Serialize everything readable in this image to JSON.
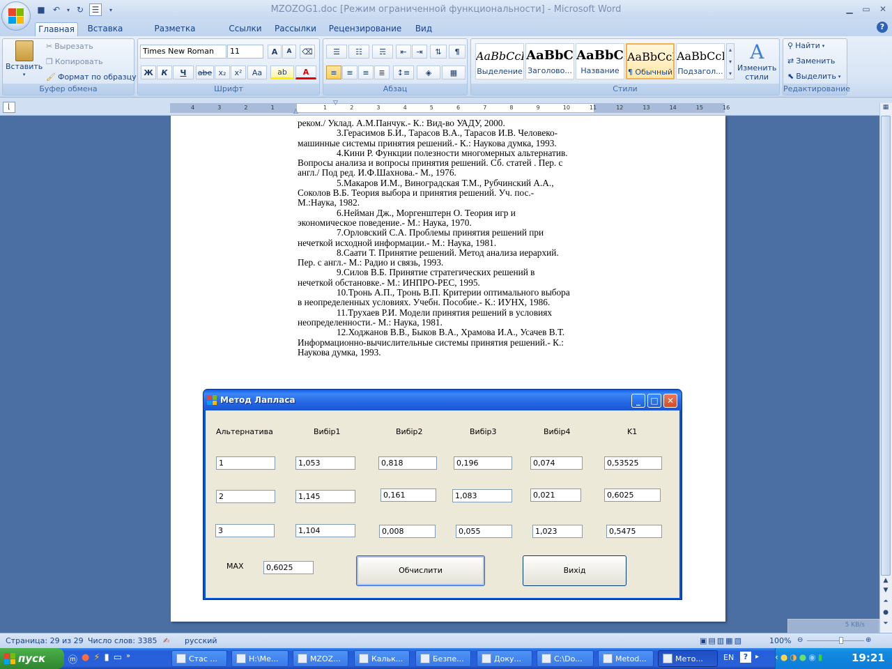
{
  "window": {
    "title": "MZOZOG1.doc [Режим ограниченной функциональности] - Microsoft Word"
  },
  "tabs": [
    "Главная",
    "Вставка",
    "Разметка страницы",
    "Ссылки",
    "Рассылки",
    "Рецензирование",
    "Вид"
  ],
  "ribbon": {
    "clipboard": {
      "paste": "Вставить",
      "cut": "Вырезать",
      "copy": "Копировать",
      "format_painter": "Формат по образцу",
      "label": "Буфер обмена"
    },
    "font": {
      "name": "Times New Roman",
      "size": "11",
      "label": "Шрифт",
      "grow": "A",
      "shrink": "A",
      "bold": "Ж",
      "italic": "К",
      "underline": "Ч",
      "strike": "abe",
      "subscript": "x₂",
      "superscript": "x²",
      "case": "Aa",
      "font_color": "A"
    },
    "paragraph": {
      "label": "Абзац"
    },
    "styles": {
      "label": "Стили",
      "items": [
        {
          "sample": "AaBbCcI",
          "name": "Выделение"
        },
        {
          "sample": "AaBbC",
          "name": "Заголово..."
        },
        {
          "sample": "AaBbC",
          "name": "Название"
        },
        {
          "sample": "AaBbCcI",
          "name": "¶ Обычный"
        },
        {
          "sample": "AaBbCcI",
          "name": "Подзагол..."
        }
      ],
      "change_line1": "Изменить",
      "change_line2": "стили"
    },
    "editing": {
      "label": "Редактирование",
      "find": "Найти",
      "replace": "Заменить",
      "select": "Выделить"
    }
  },
  "ruler": {
    "numbers": [
      "4",
      "3",
      "2",
      "1",
      "1",
      "2",
      "3",
      "4",
      "5",
      "6",
      "7",
      "8",
      "9",
      "10",
      "11",
      "12",
      "13",
      "14",
      "15",
      "16"
    ]
  },
  "document": {
    "lines": [
      {
        "text": "реком./ Уклад. А.М.Панчук.- К.: Вид-во УАДУ, 2000.",
        "indent": false
      },
      {
        "text": "3.Герасимов Б.И., Тарасов В.А., Тарасов И.В. Человеко-",
        "indent": true
      },
      {
        "text": "машинные системы принятия решений.- К.: Наукова думка, 1993.",
        "indent": false
      },
      {
        "text": "4.Кини Р. Функции полезности многомерных альтернатив.",
        "indent": true
      },
      {
        "text": "Вопросы анализа и вопросы принятия решений. Сб. статей . Пер. с",
        "indent": false
      },
      {
        "text": "англ./ Под ред. И.Ф.Шахнова.- М., 1976.",
        "indent": false
      },
      {
        "text": "5.Макаров И.М., Виноградская Т.М., Рубчинский А.А.,",
        "indent": true
      },
      {
        "text": "Соколов В.Б. Теория выбора и принятия решений. Уч. пос.-",
        "indent": false
      },
      {
        "text": "М.:Наука, 1982.",
        "indent": false
      },
      {
        "text": "6.Нейман Дж., Моргенштерн О. Теория игр и",
        "indent": true
      },
      {
        "text": "экономическое поведение.- М.: Наука, 1970.",
        "indent": false
      },
      {
        "text": "7.Орловский С.А. Проблемы принятия решений при",
        "indent": true
      },
      {
        "text": "нечеткой исходной информации.- М.: Наука, 1981.",
        "indent": false
      },
      {
        "text": "8.Саати Т. Принятие решений. Метод анализа иерархий.",
        "indent": true
      },
      {
        "text": "Пер. с англ.- М.: Радио и связь, 1993.",
        "indent": false
      },
      {
        "text": "9.Силов В.Б. Принятие стратегических решений в",
        "indent": true
      },
      {
        "text": "нечеткой обстановке.- М.: ИНПРО-РЕС, 1995.",
        "indent": false
      },
      {
        "text": "10.Тронь А.П., Тронь В.П. Критерии оптимального выбора",
        "indent": true
      },
      {
        "text": "в неопределенных условиях. Учебн. Пособие.- К.: ИУНХ, 1986.",
        "indent": false
      },
      {
        "text": "11.Трухаев Р.И. Модели принятия решений в условиях",
        "indent": true
      },
      {
        "text": "неопределенности.- М.: Наука, 1981.",
        "indent": false
      },
      {
        "text": "12.Ходжанов В.В., Быков В.А., Храмова И.А., Усачев В.Т.",
        "indent": true
      },
      {
        "text": "Информационно-вычислительные системы принятия решений.- К.:",
        "indent": false
      },
      {
        "text": "Наукова думка, 1993.",
        "indent": false
      }
    ]
  },
  "dialog": {
    "title": "Метод Лапласа",
    "headers": [
      "Альтернатива",
      "Вибір1",
      "Вибір2",
      "Вибір3",
      "Вибір4",
      "K1"
    ],
    "rows": [
      [
        "1",
        "1,053",
        "0,818",
        "0,196",
        "0,074",
        "0,53525"
      ],
      [
        "2",
        "1,145",
        "0,161",
        "1,083",
        "0,021",
        "0,6025"
      ],
      [
        "3",
        "1,104",
        "0,008",
        "0,055",
        "1,023",
        "0,5475"
      ]
    ],
    "max_label": "MAX",
    "max_value": "0,6025",
    "calc_button": "Обчислити",
    "exit_button": "Вихід"
  },
  "statusbar": {
    "page": "Страница: 29 из 29",
    "words": "Число слов: 3385",
    "language": "русский",
    "zoom": "100%"
  },
  "netspeed": "5 KB/s",
  "taskbar": {
    "start": "пуск",
    "items": [
      "Стас ...",
      "H:\\Ме...",
      "MZOZ...",
      "Кальк...",
      "Безпе...",
      "Доку...",
      "C:\\Do...",
      "Metod...",
      "Мето..."
    ],
    "lang": "EN",
    "clock": "19:21"
  }
}
